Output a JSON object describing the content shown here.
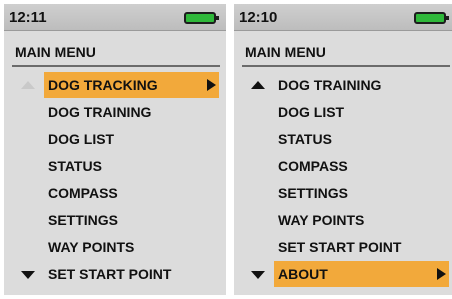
{
  "left": {
    "time": "12:11",
    "title": "MAIN MENU",
    "items": [
      "DOG TRACKING",
      "DOG TRAINING",
      "DOG LIST",
      "STATUS",
      "COMPASS",
      "SETTINGS",
      "WAY POINTS",
      "SET START POINT"
    ]
  },
  "right": {
    "time": "12:10",
    "title": "MAIN MENU",
    "items": [
      "DOG TRAINING",
      "DOG LIST",
      "STATUS",
      "COMPASS",
      "SETTINGS",
      "WAY POINTS",
      "SET START POINT",
      "ABOUT"
    ]
  },
  "colors": {
    "highlight": "#f2a93b",
    "battery": "#2fb83a",
    "screen": "#dcdcdc"
  },
  "icons": {
    "scroll_up": "triangle-up-icon",
    "scroll_down": "triangle-down-icon",
    "submenu": "arrow-right-icon",
    "battery": "battery-icon"
  }
}
